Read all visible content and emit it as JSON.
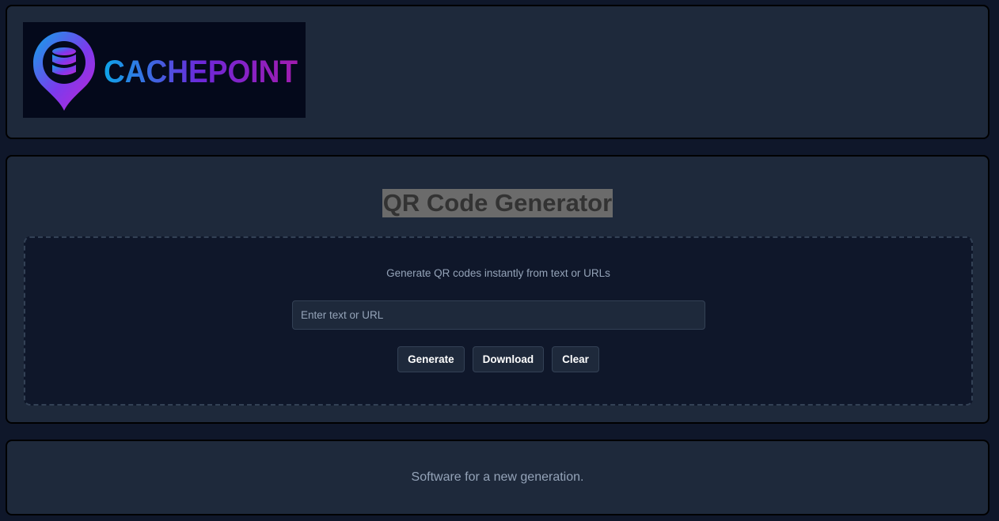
{
  "header": {
    "logo": {
      "text": "CACHEPOINT",
      "icon": "database-location-pin-icon",
      "colors": {
        "background": "#04091b",
        "gradient_start": "#0ea5e9",
        "gradient_end": "#a21caf"
      }
    }
  },
  "main": {
    "title": "QR Code Generator",
    "subtitle": "Generate QR codes instantly from text or URLs",
    "input": {
      "placeholder": "Enter text or URL",
      "value": ""
    },
    "buttons": {
      "generate": "Generate",
      "download": "Download",
      "clear": "Clear"
    }
  },
  "footer": {
    "text": "Software for a new generation."
  },
  "colors": {
    "page_background": "#0f172a",
    "panel_background": "#1e293b",
    "panel_border": "#000000",
    "muted_text": "#94a3b8",
    "button_text": "#ffffff",
    "title_highlight": "#6b6b6b",
    "title_text": "#333333"
  }
}
